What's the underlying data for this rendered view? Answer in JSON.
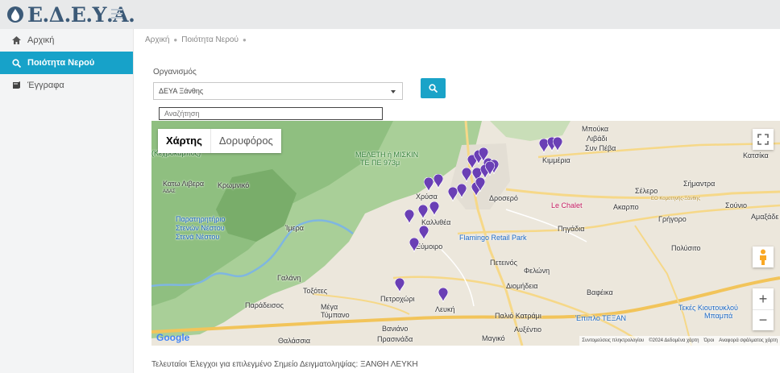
{
  "header": {
    "logo_text": "Ε.Δ.Ε.Υ.Α."
  },
  "sidebar": {
    "items": [
      {
        "label": "Αρχική",
        "icon": "home-icon",
        "active": false
      },
      {
        "label": "Ποιότητα Νερού",
        "icon": "search-icon",
        "active": true
      },
      {
        "label": "Έγγραφα",
        "icon": "book-icon",
        "active": false
      }
    ]
  },
  "breadcrumb": {
    "items": [
      "Αρχική",
      "Ποιότητα Νερού"
    ]
  },
  "form": {
    "org_label": "Οργανισμός",
    "org_selected": "ΔΕΥΑ Ξάνθης",
    "map_search_placeholder": "Αναζήτηση"
  },
  "map": {
    "type_map": "Χάρτης",
    "type_satellite": "Δορυφόρος",
    "zoom_in": "+",
    "zoom_out": "−",
    "google": "Google",
    "attribution": {
      "shortcuts": "Συντομεύσεις πληκτρολογίου",
      "data": "©2024 Δεδομένα χάρτη",
      "terms": "Όροι",
      "report": "Αναφορά σφάλματος χάρτη"
    },
    "labels": {
      "mpouka": "Μπούκα",
      "livadi": "Λιβάδι",
      "syn_peva": "Συν Πέβα",
      "katsika": "Κατσίκα",
      "kechrokampos": "(Κέχροκαμπος)",
      "meleth": "ΜΕΛΕΤΗ ή ΜΙΣΚΙΝ",
      "meleth2": "ΤΕ ΠΕ 973μ",
      "kimmeria": "Κιμμέρια",
      "kato_livera": "Κατω Λιβερα",
      "kromniko": "Κρωμνικό",
      "adas": "ΑΔΑΣ",
      "xrysa": "Χρύσα",
      "droserо": "Δροσερό",
      "le_chalet": "Le Chalet",
      "akarpo": "Ακαρπο",
      "selero": "Σέλερο",
      "simantra": "Σήμαντρα",
      "kostinos": "ΕΟ Κομοτηνής-Ξάνθης",
      "souvlo": "Σούνιο",
      "grigoro": "Γρήγορο",
      "amaxades": "Αμαξάδε",
      "paratiritirio": "Παρατηρητήριο",
      "stenon": "Στενών Νέστου",
      "stena": "Στενά Νέστου",
      "imera": "Ίμερα",
      "kallithea": "Καλλιθέα",
      "flamingo": "Flamingo Retail Park",
      "pigadia": "Πηγάδια",
      "polysito": "Πολύσιτο",
      "evmoiro": "Εύμοιρο",
      "petinos": "Πετεινός",
      "felonis": "Φελώνη",
      "galani": "Γαλάνη",
      "toxotes": "Τοξότες",
      "petrochori": "Πετροχώρι",
      "diomideia": "Διομήδεια",
      "vafeika": "Βαφέικα",
      "paradeisos": "Παράδεισος",
      "mega_tymvo": "Μέγα",
      "tymvo": "Τύμπανο",
      "lefki": "Λευκή",
      "palio_katrami": "Παλιό Κατράμι",
      "epipl_tekan": "Έπιπλο ΤΕΞΑΝ",
      "tekes": "Τεκές Κιουτουκλού",
      "mpampa": "Μπαμπά",
      "vaniano": "Βανιάνο",
      "avxentio": "Αυξέντιο",
      "magiko": "Μαγικό",
      "prasinada": "Πρασινάδα",
      "thalassia": "Θαλάσσια"
    }
  },
  "footer": {
    "title": "Τελευταίοι Έλεγχοι για επιλεγμένο Σημείο Δειγματοληψίας: ΞΑΝΘΗ ΛΕΥΚΗ"
  },
  "colors": {
    "accent": "#17a2c9",
    "pin": "#6a3fb5"
  }
}
